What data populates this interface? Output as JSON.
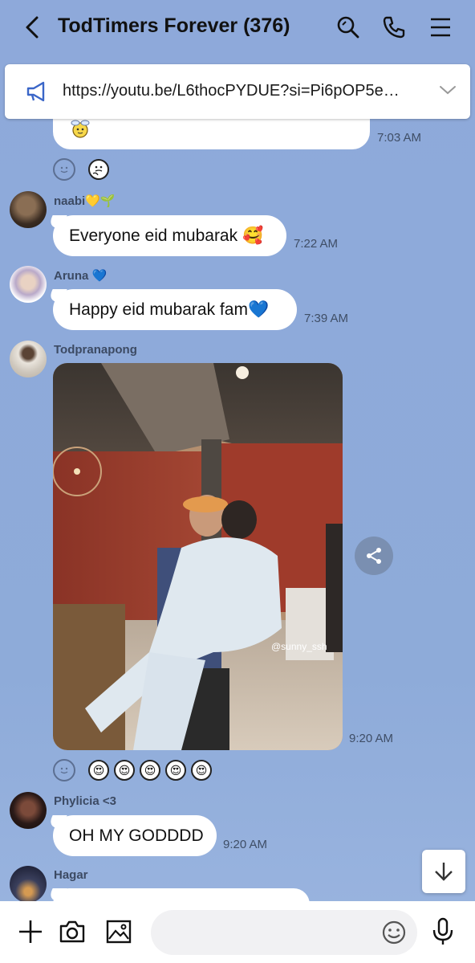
{
  "header": {
    "title": "TodTimers Forever (376)",
    "icons": [
      "back-arrow-icon",
      "search-icon",
      "phone-icon",
      "menu-icon"
    ]
  },
  "announcement": {
    "text": "https://youtu.be/L6thocPYDUE?si=Pi6pOP5e…",
    "icons": [
      "megaphone-icon",
      "chevron-down-icon"
    ]
  },
  "messages": [
    {
      "type": "sticker",
      "time": "7:03 AM"
    },
    {
      "sender": "naabi💛🌱",
      "text": "Everyone eid mubarak 🥰",
      "time": "7:22 AM"
    },
    {
      "sender": "Aruna 💙",
      "text": "Happy eid mubarak fam💙",
      "time": "7:39 AM"
    },
    {
      "sender": "Todpranapong",
      "type": "photo",
      "photo_watermark": "@sunny_ssh",
      "time": "9:20 AM"
    },
    {
      "sender": "Phylicia <3",
      "text": "OH MY GODDDD",
      "time": "9:20 AM"
    },
    {
      "sender": "Hagar"
    }
  ],
  "reactions_photo": [
    "😍",
    "😍",
    "😍",
    "😍",
    "😍"
  ],
  "composer": {
    "placeholder": "",
    "icons": [
      "plus-icon",
      "camera-icon",
      "image-icon",
      "emoji-icon",
      "mic-icon"
    ]
  },
  "colors": {
    "background": "#8fabd9",
    "bubble": "#ffffff",
    "time_text": "#3f4e66"
  }
}
